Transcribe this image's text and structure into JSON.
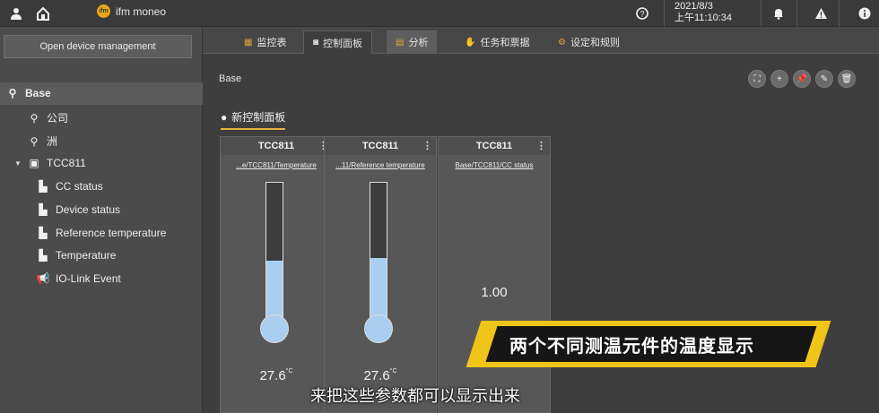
{
  "topbar": {
    "brand": "ifm moneo",
    "brand_logo_text": "ifm",
    "date": "2021/8/3",
    "time": "上午11:10:34",
    "icons": [
      "user-icon",
      "home-icon",
      "help-icon",
      "bell-icon",
      "warning-icon",
      "info-icon"
    ]
  },
  "sidebar": {
    "open_device_button": "Open device management",
    "tree": [
      {
        "label": "Base",
        "icon": "location-icon"
      },
      {
        "label": "公司",
        "icon": "location-icon"
      },
      {
        "label": "洲",
        "icon": "location-icon"
      },
      {
        "label": "TCC811",
        "icon": "device-icon"
      },
      {
        "label": "CC status",
        "icon": "chart-icon"
      },
      {
        "label": "Device status",
        "icon": "chart-icon"
      },
      {
        "label": "Reference temperature",
        "icon": "chart-icon"
      },
      {
        "label": "Temperature",
        "icon": "chart-icon"
      },
      {
        "label": "IO-Link Event",
        "icon": "megaphone-icon"
      }
    ]
  },
  "tabs": [
    {
      "label": "监控表",
      "icon": "table-icon"
    },
    {
      "label": "控制面板",
      "icon": "dashboard-icon"
    },
    {
      "label": "分析",
      "icon": "analysis-icon"
    },
    {
      "label": "任务和票据",
      "icon": "tasks-icon"
    },
    {
      "label": "设定和规则",
      "icon": "rules-icon"
    }
  ],
  "breadcrumb": "Base",
  "toolbar_icons": [
    "fullscreen-icon",
    "add-icon",
    "pin-icon",
    "edit-icon",
    "delete-icon"
  ],
  "dashboard_tab": "新控制面板",
  "widgets": [
    {
      "title": "TCC811",
      "path": "...e/TCC811/Temperature",
      "value": "27.6",
      "unit": "°C",
      "fill_fraction": 0.45
    },
    {
      "title": "TCC811",
      "path": "...11/Reference temperature",
      "value": "27.6",
      "unit": "°C",
      "fill_fraction": 0.47
    },
    {
      "title": "TCC811",
      "path": "Base/TCC811/CC status",
      "value": "1.00"
    }
  ],
  "overlay": {
    "banner": "两个不同测温元件的温度显示",
    "subtitle": "来把这些参数都可以显示出来"
  },
  "colors": {
    "accent": "#e8b040",
    "thermo_fill": "#a9cef0",
    "banner_yellow": "#f0c419"
  }
}
